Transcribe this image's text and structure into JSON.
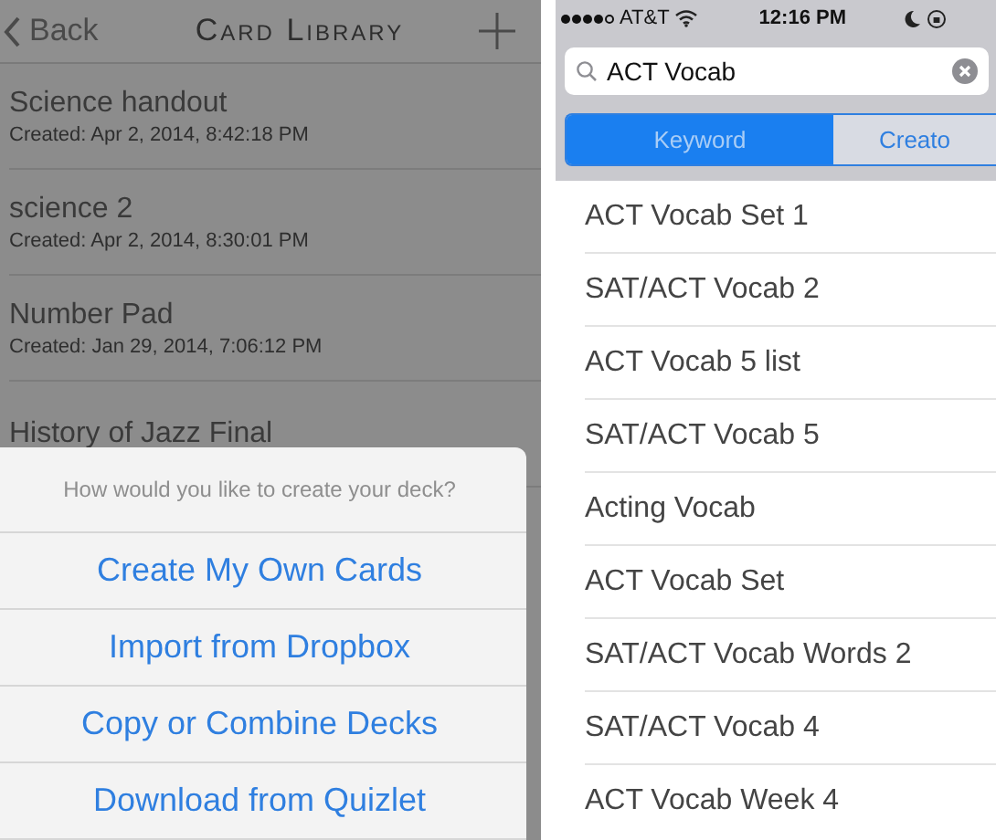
{
  "left_screen": {
    "nav": {
      "back": "Back",
      "title": "Card Library"
    },
    "decks": [
      {
        "name": "Science handout",
        "created": "Created: Apr 2, 2014, 8:42:18 PM"
      },
      {
        "name": "science 2",
        "created": "Created: Apr 2, 2014, 8:30:01 PM"
      },
      {
        "name": "Number Pad",
        "created": "Created: Jan 29, 2014, 7:06:12 PM"
      },
      {
        "name": "History of Jazz Final"
      }
    ],
    "action_sheet": {
      "message": "How would you like to create your deck?",
      "buttons": [
        "Create My Own Cards",
        "Import from Dropbox",
        "Copy or Combine Decks",
        "Download from Quizlet"
      ]
    }
  },
  "right_screen": {
    "status_bar": {
      "carrier": "AT&T",
      "time": "12:16 PM"
    },
    "search": {
      "value": "ACT Vocab"
    },
    "segments": [
      {
        "label": "Keyword",
        "selected": true
      },
      {
        "label": "Creato",
        "selected": false
      }
    ],
    "results": [
      "ACT Vocab Set 1",
      "SAT/ACT Vocab 2",
      "ACT Vocab 5 list",
      "SAT/ACT Vocab 5",
      "Acting Vocab",
      "ACT Vocab Set",
      "SAT/ACT Vocab Words 2",
      "SAT/ACT Vocab 4",
      "ACT Vocab Week 4"
    ]
  }
}
